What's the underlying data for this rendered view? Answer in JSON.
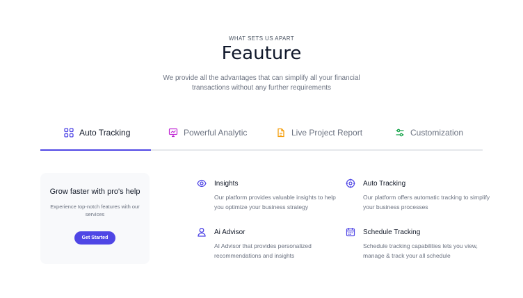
{
  "header": {
    "eyebrow": "WHAT SETS US APART",
    "title": "Feauture",
    "subtitle": "We provide all the advantages that can simplify all your financial transactions without any further requirements"
  },
  "tabs": [
    {
      "label": "Auto Tracking",
      "icon": "grid-icon",
      "color": "#4f46e5",
      "active": true
    },
    {
      "label": "Powerful Analytic",
      "icon": "presentation-chart-icon",
      "color": "#c026d3",
      "active": false
    },
    {
      "label": "Live Project Report",
      "icon": "document-icon",
      "color": "#f59e0b",
      "active": false
    },
    {
      "label": "Customization",
      "icon": "sliders-icon",
      "color": "#16a34a",
      "active": false
    }
  ],
  "promo": {
    "title": "Grow faster with pro's help",
    "description": "Experience top-notch features with our services",
    "button_label": "Get Started"
  },
  "features": [
    {
      "title": "Insights",
      "icon": "eye-icon",
      "description": "Our platform provides valuable insights to help you optimize your business strategy"
    },
    {
      "title": "Auto Tracking",
      "icon": "target-icon",
      "description": "Our platform offers automatic tracking to simplify your business processes"
    },
    {
      "title": "Ai Advisor",
      "icon": "user-icon",
      "description": "AI Advisor that provides personalized recommendations and insights"
    },
    {
      "title": "Schedule Tracking",
      "icon": "calendar-icon",
      "description": "Schedule tracking capabilities lets you view, manage & track your all schedule"
    }
  ],
  "colors": {
    "accent": "#4f46e5",
    "muted_text": "#6b7280",
    "card_bg": "#f8f9fb"
  }
}
